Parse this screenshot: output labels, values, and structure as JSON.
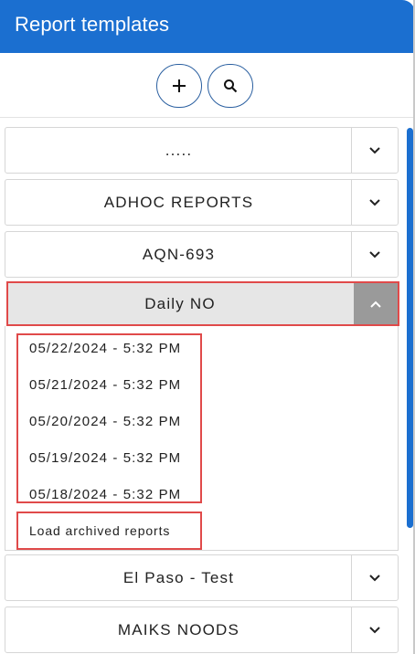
{
  "header": {
    "title": "Report templates"
  },
  "toolbar": {
    "add_icon": "plus-icon",
    "search_icon": "search-icon"
  },
  "groups": [
    {
      "label": ".....",
      "state": "collapsed"
    },
    {
      "label": "ADHOC REPORTS",
      "state": "collapsed"
    },
    {
      "label": "AQN-693",
      "state": "collapsed"
    },
    {
      "label": "Daily NO",
      "state": "expanded",
      "items": [
        "05/22/2024 - 5:32 PM",
        "05/21/2024 - 5:32 PM",
        "05/20/2024 - 5:32 PM",
        "05/19/2024 - 5:32 PM",
        "05/18/2024 - 5:32 PM"
      ],
      "archive_label": "Load archived reports"
    },
    {
      "label": "El Paso - Test",
      "state": "collapsed"
    },
    {
      "label": "MAIKS NOODS",
      "state": "collapsed"
    }
  ],
  "colors": {
    "header_bg": "#1b6fd0",
    "highlight": "#e04a4a",
    "scroll_thumb": "#1b6fd0"
  }
}
